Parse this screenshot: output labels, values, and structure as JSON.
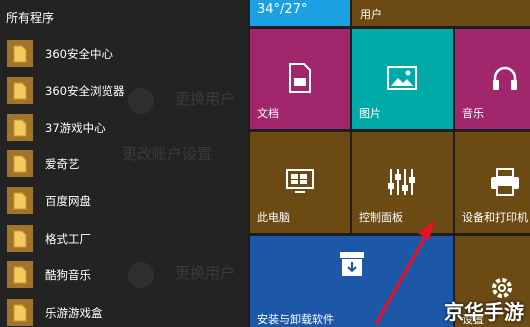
{
  "start_menu": {
    "section_header": "所有程序",
    "apps": [
      {
        "label": "360安全中心",
        "icon": "folder-icon"
      },
      {
        "label": "360安全浏览器",
        "icon": "folder-icon"
      },
      {
        "label": "37游戏中心",
        "icon": "folder-icon"
      },
      {
        "label": "爱奇艺",
        "icon": "folder-icon"
      },
      {
        "label": "百度网盘",
        "icon": "folder-icon"
      },
      {
        "label": "格式工厂",
        "icon": "folder-icon"
      },
      {
        "label": "酷狗音乐",
        "icon": "folder-icon"
      },
      {
        "label": "乐游游戏盒",
        "icon": "folder-icon"
      }
    ]
  },
  "background_ghost": {
    "user_1": "更换用户",
    "settings": "更改账户设置",
    "user_2": "更换用户"
  },
  "tiles": {
    "weather": {
      "label": "34°/27°",
      "color": "#1ba1e2"
    },
    "user": {
      "label": "用户",
      "color": "#6b4a14"
    },
    "documents": {
      "label": "文档",
      "icon": "document-icon",
      "color": "#a2266b"
    },
    "pictures": {
      "label": "图片",
      "icon": "picture-icon",
      "color": "#00aaa9"
    },
    "music": {
      "label": "音乐",
      "icon": "headphones-icon",
      "color": "#a2266b"
    },
    "this_pc": {
      "label": "此电脑",
      "icon": "monitor-icon",
      "color": "#6b4a14"
    },
    "control_panel": {
      "label": "控制面板",
      "icon": "sliders-icon",
      "color": "#6b4a14"
    },
    "devices_printers": {
      "label": "设备和打印机",
      "icon": "printer-icon",
      "color": "#6b4a14"
    },
    "uninstall": {
      "label": "安装与卸载软件",
      "icon": "box-icon",
      "color": "#1d58a8"
    },
    "settings": {
      "label": "设置",
      "icon": "gear-icon",
      "color": "#6b4a14"
    }
  },
  "annotation": {
    "color": "#e81123"
  },
  "watermark": {
    "text": "京华手游"
  }
}
